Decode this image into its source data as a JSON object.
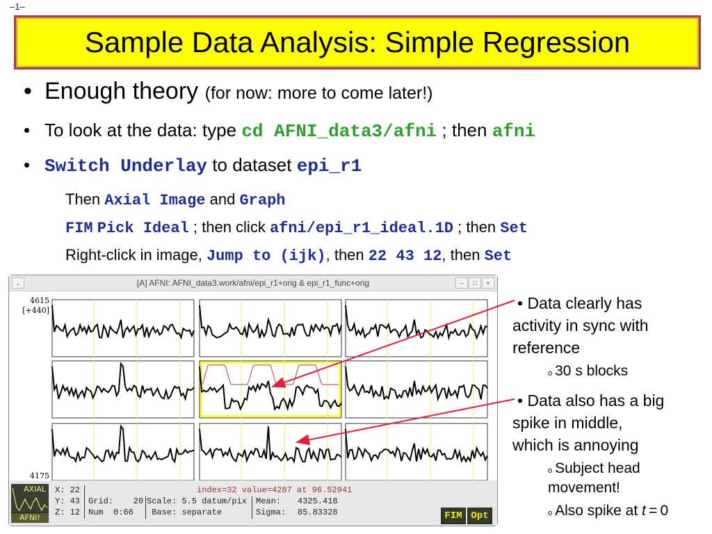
{
  "page_number": "–1–",
  "title": "Sample Data Analysis: Simple Regression",
  "bullets": {
    "b1": {
      "main": "Enough theory",
      "aside": "(for now: more to come later!)"
    },
    "b2": {
      "pre": "To look at the data: type",
      "cmd1": "cd AFNI_data3/afni",
      "mid": "; then",
      "cmd2": "afni"
    },
    "b3": {
      "cmd1": "Switch Underlay",
      "mid": "to dataset",
      "cmd2": "epi_r1"
    },
    "s1": {
      "pre": "Then",
      "cmd1": "Axial Image",
      "mid": "and",
      "cmd2": "Graph"
    },
    "s2": {
      "cmd1": "FIM",
      "cmd2": "Pick Ideal",
      "mid": "; then click",
      "cmd3": "afni/epi_r1_ideal.1D",
      "mid2": "; then",
      "cmd4": "Set"
    },
    "s3": {
      "pre": "Right-click in image,",
      "cmd1": "Jump to (ijk)",
      "mid": ", then",
      "cmd2": "22 43 12",
      "mid2": ", then",
      "cmd3": "Set"
    }
  },
  "window": {
    "title": "[A] AFNI: AFNI_data3.work/afni/epi_r1+orig & epi_r1_func+orig",
    "menu_icon": "chevron-down",
    "controls": [
      "minimize",
      "maximize",
      "close"
    ],
    "y_top": "4615",
    "y_range": "[+440]",
    "y_bottom": "4175",
    "logo_top": "AXIAL",
    "logo_bottom": "AFNI!",
    "status": {
      "x": "X: 22",
      "y": "Y: 43",
      "z": "Z: 12",
      "grid": "Grid:    20",
      "num": "Num  0:66",
      "scale": "Scale: 5.5 datum/pix",
      "base": " Base: separate",
      "index": "index=32 value=4287 at 96.52941",
      "mean_label": "Mean:",
      "mean": "4325.418",
      "sigma_label": "Sigma:",
      "sigma": "85.83328"
    },
    "buttons": {
      "fim": "FIM",
      "opt": "Opt"
    },
    "colors": {
      "ideal_curve": "#c06070",
      "grid_line": "#f0f0a0",
      "highlight": "#ffff40",
      "arrow": "#e0203a"
    }
  },
  "notes": {
    "n1_line1": "• Data clearly has",
    "n1_line2": "activity in sync with",
    "n1_line3": "reference",
    "n1_sub": "30 s blocks",
    "n2_line1": "• Data also has a big",
    "n2_line2": "spike in middle,",
    "n2_line3": "which is annoying",
    "n2_sub1a": "Subject head",
    "n2_sub1b": "movement!",
    "n2_sub2": "Also spike at ",
    "n2_sub2_var": "t",
    "n2_sub2_eq": " = 0"
  }
}
